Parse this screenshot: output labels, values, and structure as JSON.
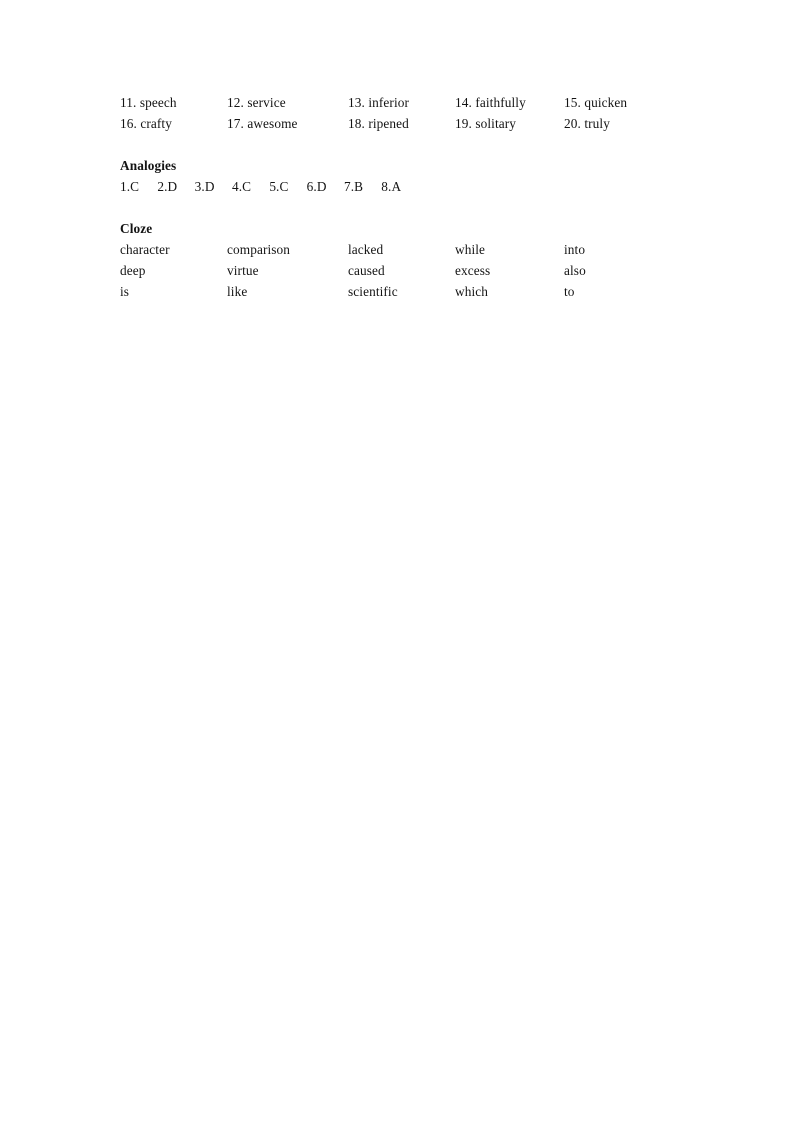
{
  "document": {
    "page_background": "#ffffff",
    "text_color": "#141414"
  },
  "vocabulary": {
    "rows": [
      [
        {
          "text": "11. speech"
        },
        {
          "text": "12. service"
        },
        {
          "text": "13. inferior"
        },
        {
          "text": "14. faithfully"
        },
        {
          "text": "15. quicken"
        }
      ],
      [
        {
          "text": "16. crafty"
        },
        {
          "text": "17. awesome"
        },
        {
          "text": "18. ripened"
        },
        {
          "text": "19. solitary"
        },
        {
          "text": "20. truly"
        }
      ]
    ]
  },
  "analogies": {
    "heading": "Analogies",
    "answers": [
      {
        "text": "1.C"
      },
      {
        "text": "2.D"
      },
      {
        "text": "3.D"
      },
      {
        "text": "4.C"
      },
      {
        "text": "5.C"
      },
      {
        "text": "6.D"
      },
      {
        "text": "7.B"
      },
      {
        "text": "8.A"
      }
    ]
  },
  "cloze": {
    "heading": "Cloze",
    "rows": [
      [
        {
          "text": "character"
        },
        {
          "text": "comparison"
        },
        {
          "text": "lacked"
        },
        {
          "text": "while"
        },
        {
          "text": "into"
        }
      ],
      [
        {
          "text": "deep"
        },
        {
          "text": "virtue"
        },
        {
          "text": "caused"
        },
        {
          "text": "excess"
        },
        {
          "text": "also"
        }
      ],
      [
        {
          "text": "is"
        },
        {
          "text": "like"
        },
        {
          "text": "scientific"
        },
        {
          "text": "which"
        },
        {
          "text": "to"
        }
      ]
    ]
  }
}
